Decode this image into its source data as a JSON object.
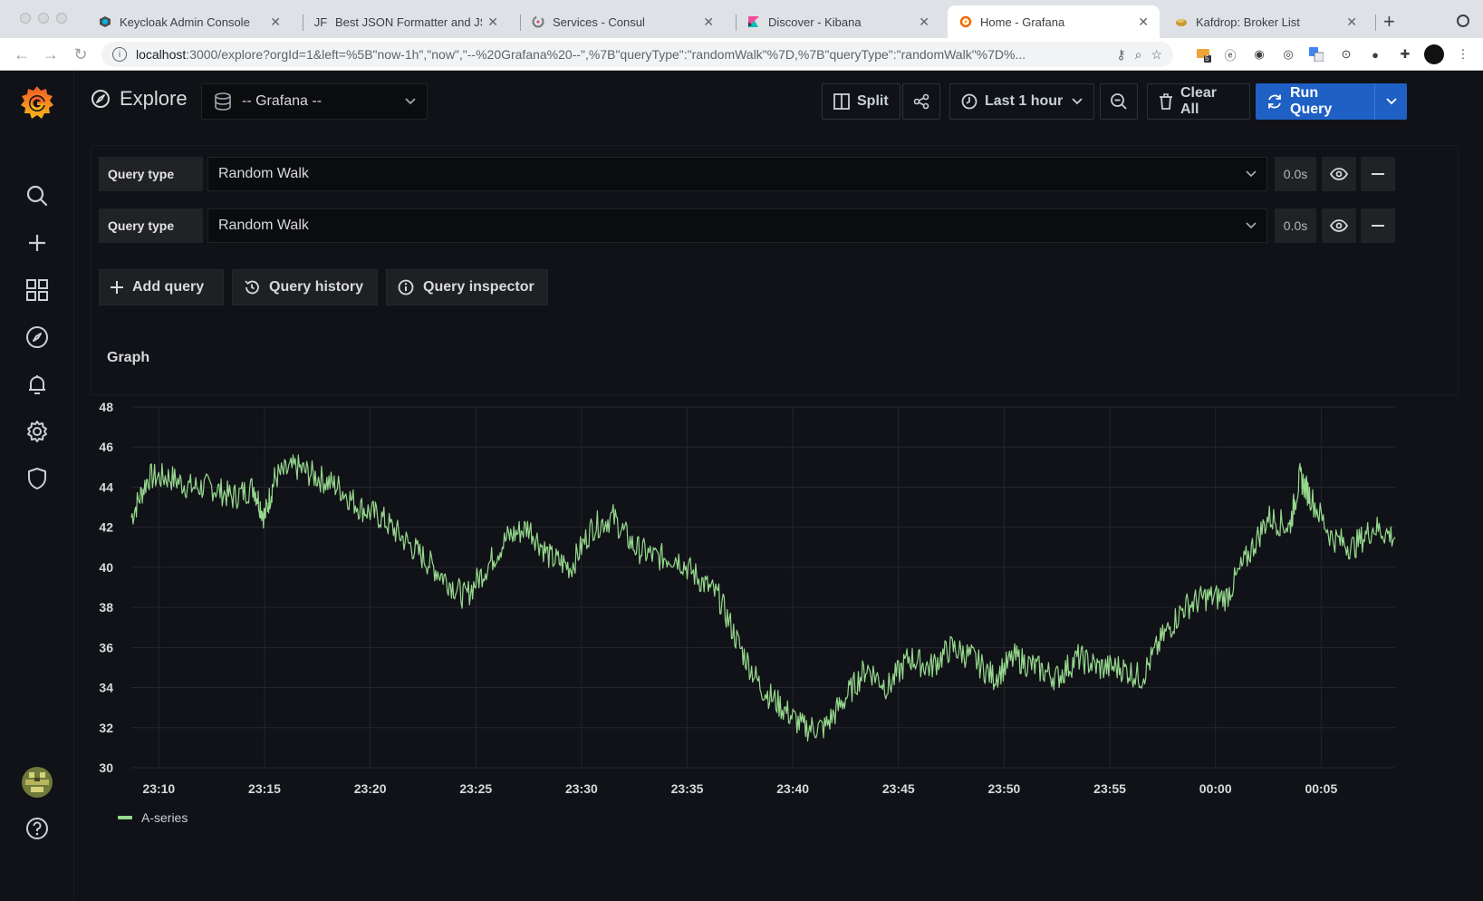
{
  "browser": {
    "tabs": [
      {
        "title": "Keycloak Admin Console",
        "icon": "keycloak-icon",
        "active": false
      },
      {
        "title": "Best JSON Formatter and JSO",
        "icon": "jsonformatter-icon",
        "icon_text": "JF",
        "active": false
      },
      {
        "title": "Services - Consul",
        "icon": "consul-icon",
        "active": false
      },
      {
        "title": "Discover - Kibana",
        "icon": "kibana-icon",
        "active": false
      },
      {
        "title": "Home - Grafana",
        "icon": "grafana-icon",
        "active": true
      },
      {
        "title": "Kafdrop: Broker List",
        "icon": "kafdrop-icon",
        "active": false
      }
    ],
    "url_host": "localhost",
    "url_rest": ":3000/explore?orgId=1&left=%5B\"now-1h\",\"now\",\"--%20Grafana%20--\",%7B\"queryType\":\"randomWalk\"%7D,%7B\"queryType\":\"randomWalk\"%7D%...",
    "extension_badge": "5"
  },
  "explore": {
    "title": "Explore",
    "datasource": "-- Grafana --",
    "split_label": "Split",
    "time_range": "Last 1 hour",
    "clear_label": "Clear All",
    "run_label": "Run Query"
  },
  "queries": [
    {
      "label": "Query type",
      "value": "Random Walk",
      "time": "0.0s"
    },
    {
      "label": "Query type",
      "value": "Random Walk",
      "time": "0.0s"
    }
  ],
  "query_actions": {
    "add": "Add query",
    "history": "Query history",
    "inspector": "Query inspector"
  },
  "graph": {
    "title": "Graph"
  },
  "colors": {
    "accent": "#1f60c4",
    "series": "#96d98d",
    "grafana_orange": "#f46800"
  },
  "chart_data": {
    "type": "line",
    "title": "Graph",
    "xlabel": "",
    "ylabel": "",
    "ylim": [
      30,
      48
    ],
    "yticks": [
      30,
      32,
      34,
      36,
      38,
      40,
      42,
      44,
      46,
      48
    ],
    "xlim": [
      "23:08:42",
      "00:08:30"
    ],
    "xticks": [
      "23:10",
      "23:15",
      "23:20",
      "23:25",
      "23:30",
      "23:35",
      "23:40",
      "23:45",
      "23:50",
      "23:55",
      "00:00",
      "00:05"
    ],
    "grid": true,
    "legend": "bottom-left",
    "series": [
      {
        "name": "A-series",
        "x": [
          "23:08:42",
          "23:09:30",
          "23:10:30",
          "23:11:30",
          "23:12:30",
          "23:13:30",
          "23:14:30",
          "23:15:00",
          "23:15:30",
          "23:16:30",
          "23:17:30",
          "23:18:30",
          "23:19:30",
          "23:20:30",
          "23:21:30",
          "23:22:30",
          "23:23:30",
          "23:24:30",
          "23:25:30",
          "23:26:30",
          "23:27:30",
          "23:28:30",
          "23:29:30",
          "23:30:30",
          "23:31:30",
          "23:32:30",
          "23:33:30",
          "23:34:30",
          "23:35:30",
          "23:36:30",
          "23:37:30",
          "23:38:30",
          "23:39:30",
          "23:40:30",
          "23:41:30",
          "23:42:30",
          "23:43:30",
          "23:44:30",
          "23:45:30",
          "23:46:30",
          "23:47:30",
          "23:48:30",
          "23:49:30",
          "23:50:30",
          "23:51:30",
          "23:52:30",
          "23:53:30",
          "23:54:30",
          "23:55:30",
          "23:56:30",
          "23:57:30",
          "23:58:30",
          "23:59:30",
          "00:00:30",
          "00:01:30",
          "00:02:30",
          "00:03:30",
          "00:04:00",
          "00:04:30",
          "00:05:30",
          "00:06:30",
          "00:07:30",
          "00:08:30"
        ],
        "values": [
          42.5,
          44.5,
          44.5,
          44.0,
          44.0,
          43.5,
          44.0,
          42.5,
          44.5,
          45.0,
          44.5,
          44.0,
          43.0,
          42.5,
          41.5,
          40.5,
          39.5,
          38.5,
          40.0,
          41.5,
          42.0,
          40.5,
          40.0,
          42.0,
          42.5,
          41.0,
          40.5,
          40.5,
          39.5,
          38.5,
          36.0,
          34.0,
          33.0,
          32.0,
          32.0,
          33.5,
          35.0,
          34.0,
          35.5,
          35.0,
          36.0,
          35.5,
          34.5,
          35.5,
          35.0,
          34.5,
          35.5,
          35.0,
          35.0,
          34.5,
          36.5,
          38.0,
          38.5,
          38.5,
          40.5,
          42.5,
          42.0,
          44.5,
          43.5,
          41.5,
          41.0,
          42.0,
          41.5
        ]
      }
    ]
  }
}
